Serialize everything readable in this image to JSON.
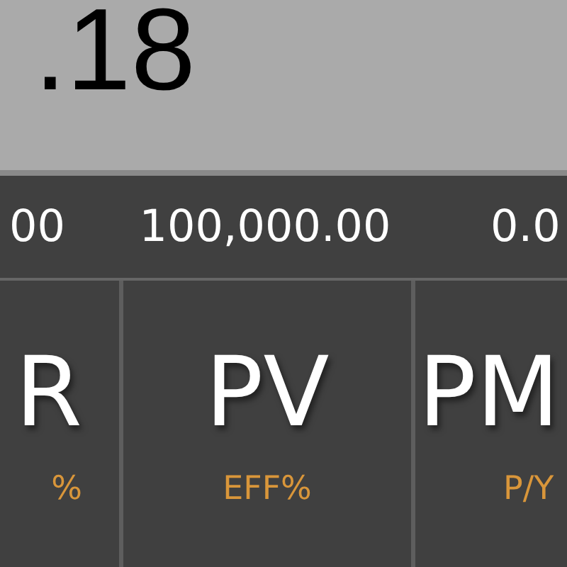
{
  "display": {
    "value": ".18"
  },
  "registers": [
    {
      "value": "00"
    },
    {
      "value": "100,000.00"
    },
    {
      "value": "0.0"
    }
  ],
  "keys": [
    {
      "label": "R",
      "secondary": "%"
    },
    {
      "label": "PV",
      "secondary": "EFF%"
    },
    {
      "label": "PM",
      "secondary": "P/Y"
    }
  ]
}
